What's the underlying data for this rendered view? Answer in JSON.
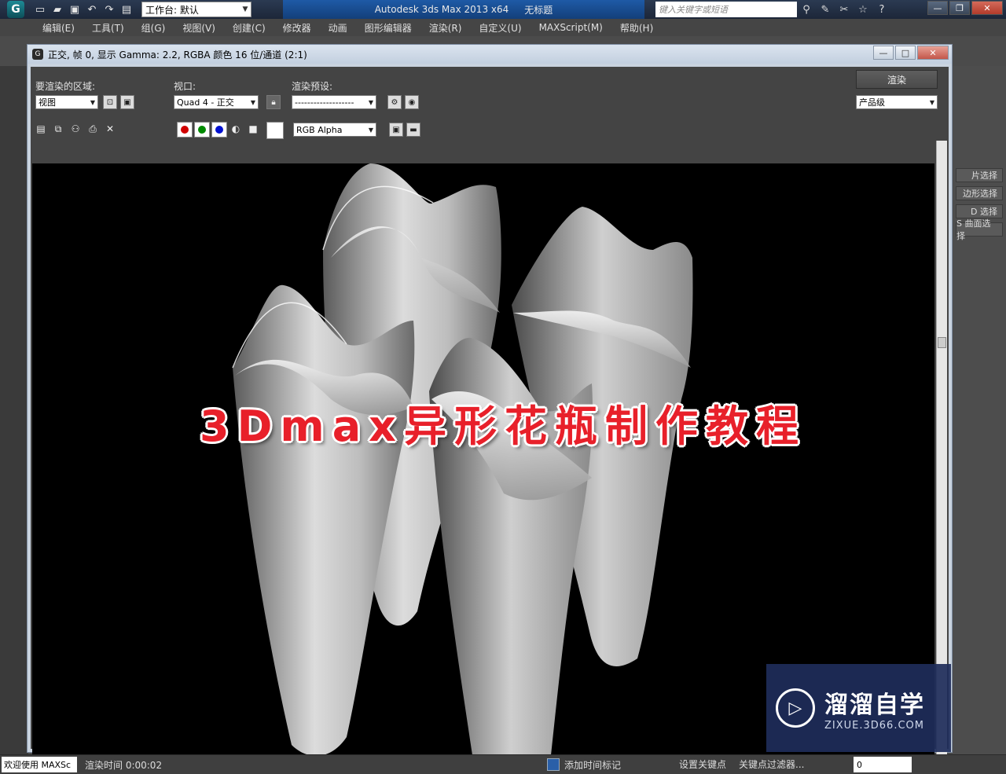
{
  "titlebar": {
    "workspace": "工作台: 默认",
    "app_name": "Autodesk 3ds Max  2013 x64",
    "doc_name": "无标题",
    "search_placeholder": "键入关键字或短语"
  },
  "menubar": {
    "items": [
      "编辑(E)",
      "工具(T)",
      "组(G)",
      "视图(V)",
      "创建(C)",
      "修改器",
      "动画",
      "图形编辑器",
      "渲染(R)",
      "自定义(U)",
      "MAXScript(M)",
      "帮助(H)"
    ]
  },
  "render_window": {
    "title": "正交, 帧 0, 显示 Gamma: 2.2, RGBA 颜色 16 位/通道 (2:1)",
    "area_label": "要渲染的区域:",
    "area_value": "视图",
    "viewport_label": "视口:",
    "viewport_value": "Quad 4 - 正交",
    "preset_label": "渲染预设:",
    "preset_value": "-------------------",
    "render_button": "渲染",
    "quality_value": "产品级",
    "channel_value": "RGB Alpha"
  },
  "right_panel": {
    "items": [
      "片选择",
      "边形选择",
      "D 选择",
      "S 曲面选择"
    ]
  },
  "overlay": {
    "title": "3Dmax异形花瓶制作教程"
  },
  "watermark": {
    "brand": "溜溜自学",
    "url": "ZIXUE.3D66.COM"
  },
  "statusbar": {
    "welcome": "欢迎使用 MAXSc",
    "render_time": "渲染时间 0:00:02",
    "add_time_tag": "添加时间标记",
    "set_key": "设置关键点",
    "key_filter": "关键点过滤器...",
    "frame": "0"
  },
  "colors": {
    "overlay_text": "#e8202a",
    "red_channel": "#d00000",
    "green_channel": "#008a00",
    "blue_channel": "#0010d0"
  }
}
